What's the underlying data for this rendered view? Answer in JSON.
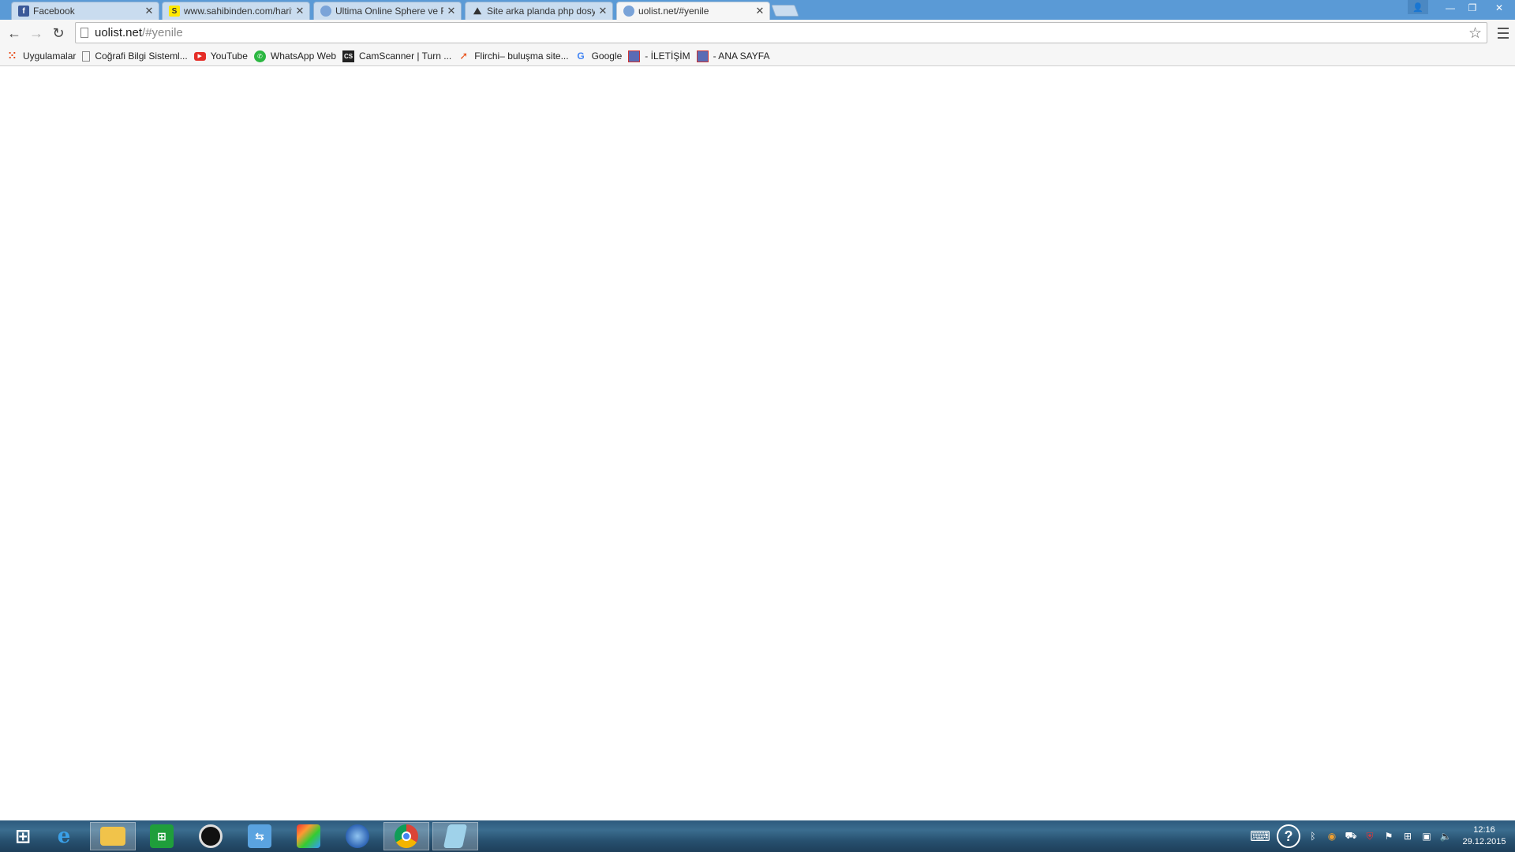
{
  "tabs": [
    {
      "title": "Facebook",
      "icon": "facebook-icon",
      "active": false
    },
    {
      "title": "www.sahibinden.com/harit",
      "icon": "sahibinden-icon",
      "active": false
    },
    {
      "title": "Ultima Online Sphere ve R",
      "icon": "globe-icon",
      "active": false
    },
    {
      "title": "Site arka planda php dosy",
      "icon": "site-icon",
      "active": false
    },
    {
      "title": "uolist.net/#yenile",
      "icon": "globe-icon",
      "active": true
    }
  ],
  "address": {
    "host": "uolist.net",
    "path": "/#yenile"
  },
  "bookmarks": [
    {
      "label": "Uygulamalar",
      "icon": "apps-grid-icon"
    },
    {
      "label": "Coğrafi Bilgi Sisteml...",
      "icon": "page-icon"
    },
    {
      "label": "YouTube",
      "icon": "youtube-icon"
    },
    {
      "label": "WhatsApp Web",
      "icon": "whatsapp-icon"
    },
    {
      "label": "CamScanner | Turn ...",
      "icon": "camscanner-icon"
    },
    {
      "label": "Flirchi– buluşma site...",
      "icon": "flirchi-icon"
    },
    {
      "label": "Google",
      "icon": "google-icon"
    },
    {
      "label": "- İLETİŞİM",
      "icon": "site-badge-icon"
    },
    {
      "label": "- ANA SAYFA",
      "icon": "site-badge-icon"
    }
  ],
  "taskbar": {
    "apps": [
      {
        "name": "windows-start-icon",
        "active": false
      },
      {
        "name": "internet-explorer-icon",
        "active": false
      },
      {
        "name": "file-explorer-icon",
        "active": true
      },
      {
        "name": "store-icon",
        "active": false
      },
      {
        "name": "media-player-icon",
        "active": false
      },
      {
        "name": "remote-app-icon",
        "active": false
      },
      {
        "name": "photo-app-icon",
        "active": false
      },
      {
        "name": "google-earth-icon",
        "active": false
      },
      {
        "name": "chrome-icon",
        "active": true
      },
      {
        "name": "notepad-icon",
        "active": true
      }
    ],
    "clock": {
      "time": "12:16",
      "date": "29.12.2015"
    }
  },
  "colors": {
    "titlebar": "#5a9ad6",
    "tab_inactive": "#c9dcef",
    "tab_active": "#f6f6f6",
    "toolbar": "#f6f6f6"
  }
}
